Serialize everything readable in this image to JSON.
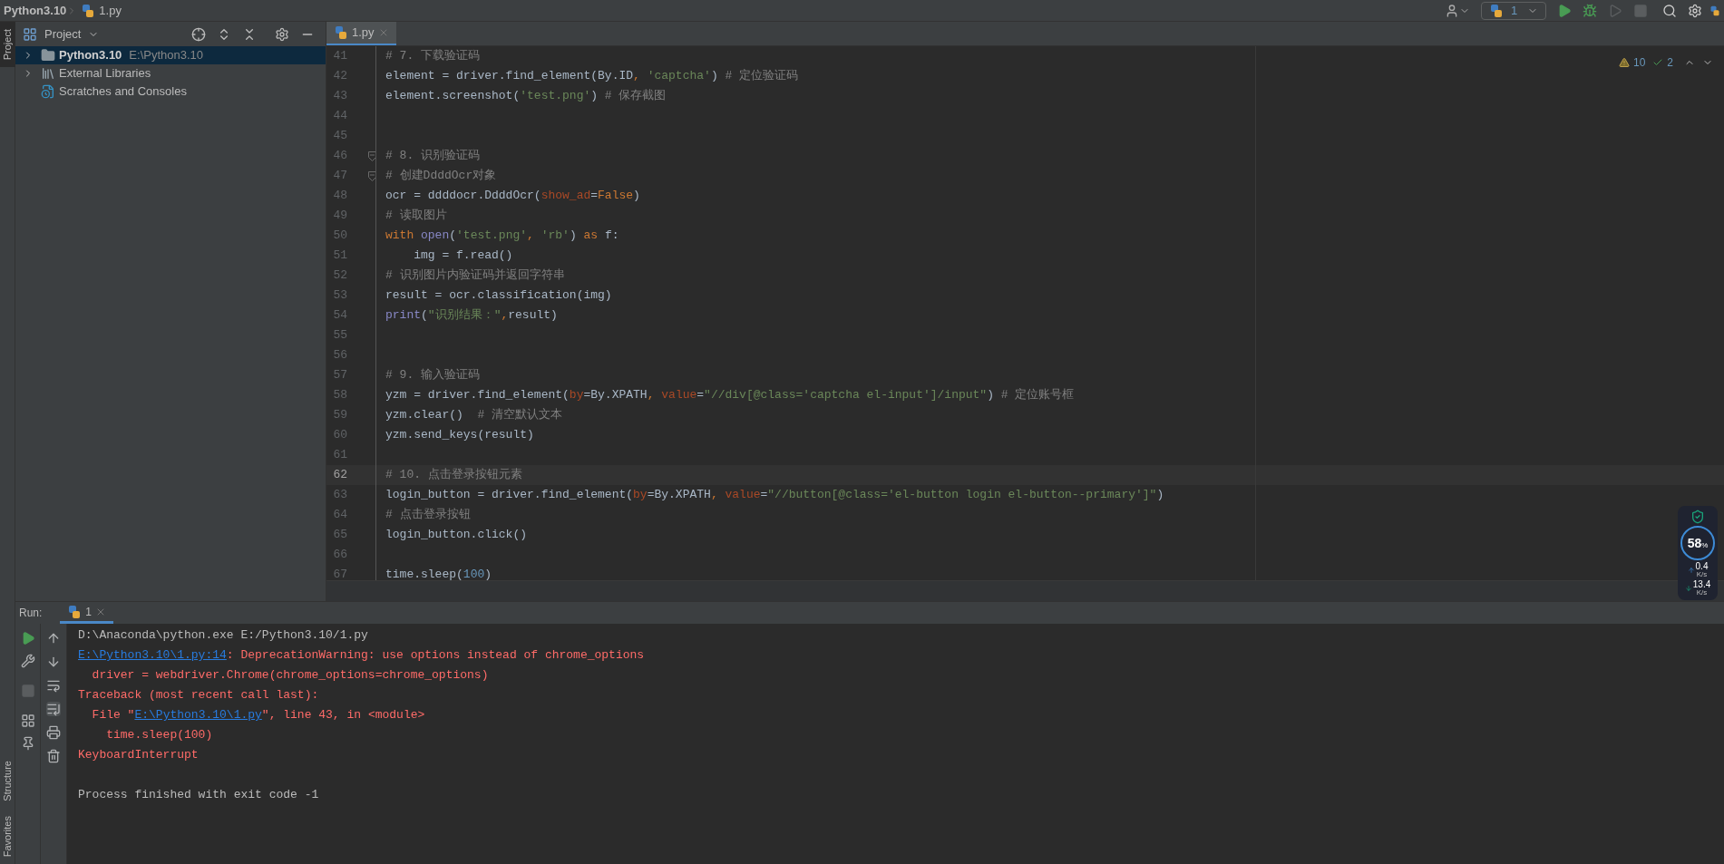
{
  "title_bar": {
    "project": "Python3.10",
    "file": "1.py"
  },
  "run_config": {
    "label": "1"
  },
  "tool_strip": {
    "top": [
      {
        "label": "Project",
        "selected": true
      }
    ],
    "bottom": [
      {
        "label": "Structure",
        "selected": false
      },
      {
        "label": "Favorites",
        "selected": false
      }
    ]
  },
  "project_panel": {
    "title": "Project",
    "tree": [
      {
        "label": "Python3.10",
        "path": "E:\\Python3.10",
        "kind": "folder",
        "has_children": true,
        "selected": true
      },
      {
        "label": "External Libraries",
        "kind": "library",
        "has_children": true,
        "selected": false
      },
      {
        "label": "Scratches and Consoles",
        "kind": "scratches",
        "has_children": false,
        "selected": false
      }
    ]
  },
  "editor": {
    "tabs": [
      {
        "label": "1.py",
        "selected": true
      }
    ],
    "inspections": {
      "warnings": "10",
      "weak_warnings": "2"
    },
    "lines": [
      {
        "number": "41",
        "fold": false,
        "current": false,
        "tokens": [
          {
            "kind": "comment",
            "text": "# 7. 下载验证码"
          }
        ]
      },
      {
        "number": "42",
        "fold": false,
        "current": false,
        "tokens": [
          {
            "kind": "plain",
            "text": "element = driver.find_element(By.ID"
          },
          {
            "kind": "keyword",
            "text": ", "
          },
          {
            "kind": "string",
            "text": "'captcha'"
          },
          {
            "kind": "plain",
            "text": ")"
          },
          {
            "kind": "comment",
            "text": " # 定位验证码"
          }
        ]
      },
      {
        "number": "43",
        "fold": false,
        "current": false,
        "tokens": [
          {
            "kind": "plain",
            "text": "element.screenshot("
          },
          {
            "kind": "string",
            "text": "'test.png'"
          },
          {
            "kind": "plain",
            "text": ")"
          },
          {
            "kind": "comment",
            "text": " # 保存截图"
          }
        ]
      },
      {
        "number": "44",
        "fold": false,
        "current": false
      },
      {
        "number": "45",
        "fold": false,
        "current": false
      },
      {
        "number": "46",
        "fold": true,
        "current": false,
        "tokens": [
          {
            "kind": "comment",
            "text": "# 8. 识别验证码"
          }
        ]
      },
      {
        "number": "47",
        "fold": true,
        "current": false,
        "tokens": [
          {
            "kind": "comment",
            "text": "# 创建DdddOcr对象"
          }
        ]
      },
      {
        "number": "48",
        "fold": false,
        "current": false,
        "tokens": [
          {
            "kind": "plain",
            "text": "ocr = ddddocr.DdddOcr("
          },
          {
            "kind": "param",
            "text": "show_ad"
          },
          {
            "kind": "plain",
            "text": "="
          },
          {
            "kind": "keyword",
            "text": "False"
          },
          {
            "kind": "plain",
            "text": ")"
          }
        ]
      },
      {
        "number": "49",
        "fold": false,
        "current": false,
        "tokens": [
          {
            "kind": "comment",
            "text": "# 读取图片"
          }
        ]
      },
      {
        "number": "50",
        "fold": false,
        "current": false,
        "tokens": [
          {
            "kind": "keyword",
            "text": "with "
          },
          {
            "kind": "builtin",
            "text": "open"
          },
          {
            "kind": "plain",
            "text": "("
          },
          {
            "kind": "string",
            "text": "'test.png'"
          },
          {
            "kind": "keyword",
            "text": ", "
          },
          {
            "kind": "string",
            "text": "'rb'"
          },
          {
            "kind": "plain",
            "text": ") "
          },
          {
            "kind": "keyword",
            "text": "as"
          },
          {
            "kind": "plain",
            "text": " f:"
          }
        ]
      },
      {
        "number": "51",
        "fold": false,
        "current": false,
        "tokens": [
          {
            "kind": "plain",
            "text": "    img = f.read()"
          }
        ]
      },
      {
        "number": "52",
        "fold": false,
        "current": false,
        "tokens": [
          {
            "kind": "comment",
            "text": "# 识别图片内验证码并返回字符串"
          }
        ]
      },
      {
        "number": "53",
        "fold": false,
        "current": false,
        "tokens": [
          {
            "kind": "plain",
            "text": "result = ocr.classification(img)"
          }
        ]
      },
      {
        "number": "54",
        "fold": false,
        "current": false,
        "tokens": [
          {
            "kind": "builtin",
            "text": "print"
          },
          {
            "kind": "plain",
            "text": "("
          },
          {
            "kind": "string",
            "text": "\"识别结果：\""
          },
          {
            "kind": "keyword",
            "text": ","
          },
          {
            "kind": "plain",
            "text": "result)"
          }
        ]
      },
      {
        "number": "55",
        "fold": false,
        "current": false
      },
      {
        "number": "56",
        "fold": false,
        "current": false
      },
      {
        "number": "57",
        "fold": false,
        "current": false,
        "tokens": [
          {
            "kind": "comment",
            "text": "# 9. 输入验证码"
          }
        ]
      },
      {
        "number": "58",
        "fold": false,
        "current": false,
        "tokens": [
          {
            "kind": "plain",
            "text": "yzm = driver.find_element("
          },
          {
            "kind": "param",
            "text": "by"
          },
          {
            "kind": "plain",
            "text": "=By.XPATH"
          },
          {
            "kind": "keyword",
            "text": ", "
          },
          {
            "kind": "param",
            "text": "value"
          },
          {
            "kind": "plain",
            "text": "="
          },
          {
            "kind": "string",
            "text": "\"//div[@class='captcha el-input']/input\""
          },
          {
            "kind": "plain",
            "text": ")"
          },
          {
            "kind": "comment",
            "text": " # 定位账号框"
          }
        ]
      },
      {
        "number": "59",
        "fold": false,
        "current": false,
        "tokens": [
          {
            "kind": "plain",
            "text": "yzm.clear()"
          },
          {
            "kind": "comment",
            "text": "  # 清空默认文本"
          }
        ]
      },
      {
        "number": "60",
        "fold": false,
        "current": false,
        "tokens": [
          {
            "kind": "plain",
            "text": "yzm.send_keys(result)"
          }
        ]
      },
      {
        "number": "61",
        "fold": false,
        "current": false
      },
      {
        "number": "62",
        "fold": false,
        "current": true,
        "tokens": [
          {
            "kind": "comment",
            "text": "# 10. 点击登录按钮元素"
          }
        ]
      },
      {
        "number": "63",
        "fold": false,
        "current": false,
        "tokens": [
          {
            "kind": "plain",
            "text": "login_button = driver.find_element("
          },
          {
            "kind": "param",
            "text": "by"
          },
          {
            "kind": "plain",
            "text": "=By.XPATH"
          },
          {
            "kind": "keyword",
            "text": ", "
          },
          {
            "kind": "param",
            "text": "value"
          },
          {
            "kind": "plain",
            "text": "="
          },
          {
            "kind": "string",
            "text": "\"//button[@class='el-button login el-button--primary']\""
          },
          {
            "kind": "plain",
            "text": ")"
          }
        ]
      },
      {
        "number": "64",
        "fold": false,
        "current": false,
        "tokens": [
          {
            "kind": "comment",
            "text": "# 点击登录按钮"
          }
        ]
      },
      {
        "number": "65",
        "fold": false,
        "current": false,
        "tokens": [
          {
            "kind": "plain",
            "text": "login_button.click()"
          }
        ]
      },
      {
        "number": "66",
        "fold": false,
        "current": false
      },
      {
        "number": "67",
        "fold": false,
        "current": false,
        "tokens": [
          {
            "kind": "plain",
            "text": "time.sleep("
          },
          {
            "kind": "number",
            "text": "100"
          },
          {
            "kind": "plain",
            "text": ")"
          }
        ]
      }
    ]
  },
  "run_panel": {
    "label": "Run:",
    "tabs": [
      {
        "label": "1",
        "selected": true
      }
    ],
    "console": [
      {
        "kind": "info",
        "segments": [
          {
            "text": "D:\\Anaconda\\python.exe E:/Python3.10/1.py",
            "link": false
          }
        ]
      },
      {
        "kind": "error",
        "segments": [
          {
            "text": "E:\\Python3.10\\1.py:14",
            "link": true
          },
          {
            "text": ": DeprecationWarning: use options instead of chrome_options",
            "link": false
          }
        ]
      },
      {
        "kind": "error",
        "segments": [
          {
            "text": "  driver = webdriver.Chrome(chrome_options=chrome_options)",
            "link": false
          }
        ]
      },
      {
        "kind": "error",
        "segments": [
          {
            "text": "Traceback (most recent call last):",
            "link": false
          }
        ]
      },
      {
        "kind": "error",
        "segments": [
          {
            "text": "  File \"",
            "link": false
          },
          {
            "text": "E:\\Python3.10\\1.py",
            "link": true
          },
          {
            "text": "\", line 43, in <module>",
            "link": false
          }
        ]
      },
      {
        "kind": "error",
        "segments": [
          {
            "text": "    time.sleep(100)",
            "link": false
          }
        ]
      },
      {
        "kind": "error",
        "segments": [
          {
            "text": "KeyboardInterrupt",
            "link": false
          }
        ]
      },
      {
        "kind": "exit",
        "segments": [
          {
            "text": "Process finished with exit code -1",
            "link": false
          }
        ]
      }
    ]
  },
  "net_monitor": {
    "percent": "58",
    "percent_sign": "%",
    "upload": "0.4",
    "upload_unit": "K/s",
    "download": "13.4",
    "download_unit": "K/s"
  }
}
